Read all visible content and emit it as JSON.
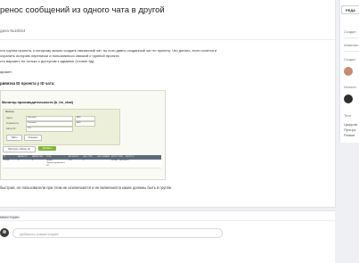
{
  "task": {
    "title": "ренос сообщений из одного чата в другой",
    "meta": "дача №10024",
    "description_lines": [
      "сть группа проекта, к которому можно создать связанный чат, но есть давно созданный чат по проекту. Что делать, если хочется и",
      "охранить историю переписки и пользоваться связкой с группой проекта",
      "сть вариант, но только с доступом к админке (точнее бд)."
    ],
    "variant_label": "ариант:",
    "section_label": "ривязка ID проекта у ID чата:",
    "bottom_text": "быстрая, но пользователи при этом не исключаются и не включаются какие должны быть в группе."
  },
  "screenshot": {
    "title": "Монитор производительности (b_im_chat)",
    "filter": {
      "title": "Фильтр",
      "rows": [
        {
          "label": "Здесь",
          "value": "Значение",
          "op": "AND"
        },
        {
          "label": "Ограничить",
          "value": "Значение",
          "op": "AND"
        },
        {
          "label": "Автор ID",
          "value": "126",
          "op": ""
        }
      ],
      "find_label": "Найти",
      "cancel_label": "Отменить"
    },
    "toolbar": {
      "list_label": "Настроить таблицу (2)",
      "add_label": "Добавить"
    },
    "columns": [
      "ID",
      "PARENT ID",
      "PARENT MID",
      "TITLE",
      "AUTHOR ID",
      "CALL TYPE",
      "CALL NUMBER",
      "ENTITY TYPE",
      "ENTITY ID"
    ],
    "row": [
      "12345",
      "0",
      "0",
      "Проект \"Компостирование и 3D\"",
      "126",
      "0",
      "",
      "SONET_GROUP",
      "270"
    ]
  },
  "comments": {
    "tab_label": "мментарии",
    "input_placeholder": "Добавить комментарий"
  },
  "sidebar": {
    "button_label": "РЕДА",
    "labels": [
      "Создан",
      "Изменен",
      "Создат",
      "Исполн",
      "Теги"
    ],
    "tags_text": [
      "Цифров",
      "Програ",
      "Развит"
    ]
  }
}
